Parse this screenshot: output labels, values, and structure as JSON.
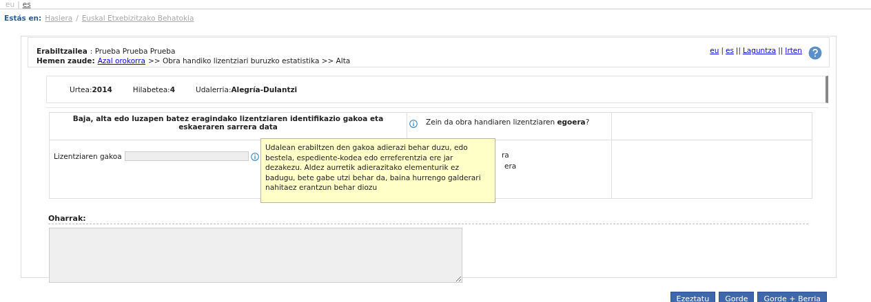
{
  "language_links": [
    {
      "label": "eu",
      "selected": false
    },
    {
      "label": "es",
      "selected": true
    }
  ],
  "language_separator": "|",
  "breadcrumb": {
    "label": "Estás en:",
    "items": [
      "Hasiera",
      "Euskal Etxebizitzako Behatokia"
    ],
    "separator": "/"
  },
  "header": {
    "user_label": "Erabiltzailea",
    "user_value": ": Prueba Prueba Prueba",
    "location_label": "Hemen zaude:",
    "location_link": "Azal orokorra",
    "location_rest": ">> Obra handiko lizentziari buruzko estatistika >> Alta",
    "links": [
      "eu",
      "|",
      "es",
      "||",
      "Laguntza",
      "||",
      "Irten"
    ]
  },
  "info": [
    {
      "label": "Urtea:",
      "value": "2014"
    },
    {
      "label": "Hilabetea:",
      "value": "4"
    },
    {
      "label": "Udalerria:",
      "value": "Alegría-Dulantzi"
    }
  ],
  "form": {
    "column_1_heading": "Baja, alta edo luzapen batez eragindako lizentziaren identifikazio gakoa eta eskaeraren sarrera data",
    "key_label": "Lizentziaren gakoa",
    "question": "Zein da obra handiaren lizentziaren **egoera**?",
    "options_visible": [
      "ra",
      "era"
    ]
  },
  "tooltip": "Udalean erabiltzen den gakoa adierazi behar duzu, edo bestela, espediente-kodea edo erreferentzia ere jar dezakezu. Aldez aurretik adierazitako elementurik ez badugu, bete gabe utzi behar da, baina hurrengo galderari nahitaez erantzun behar diozu",
  "notes": {
    "label": "Oharrak:"
  },
  "buttons": [
    "Ezeztatu",
    "Gorde",
    "Gorde + Berria"
  ]
}
